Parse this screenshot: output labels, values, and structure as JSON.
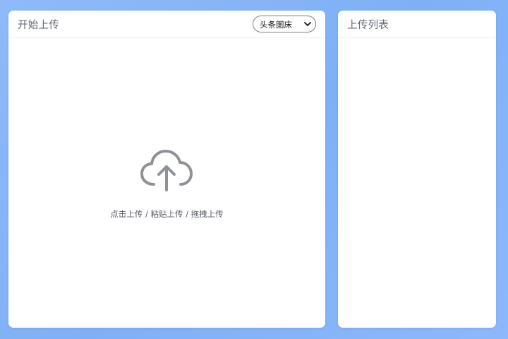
{
  "upload_panel": {
    "title": "开始上传",
    "host_select": {
      "selected": "头条图床"
    },
    "upload_icon": "cloud-upload-icon",
    "hint": "点击上传 / 粘贴上传 / 拖拽上传"
  },
  "list_panel": {
    "title": "上传列表",
    "items": []
  },
  "colors": {
    "background": "#7fb0f6",
    "panel": "#ffffff",
    "icon": "#8e9198",
    "text": "#5f6470"
  }
}
